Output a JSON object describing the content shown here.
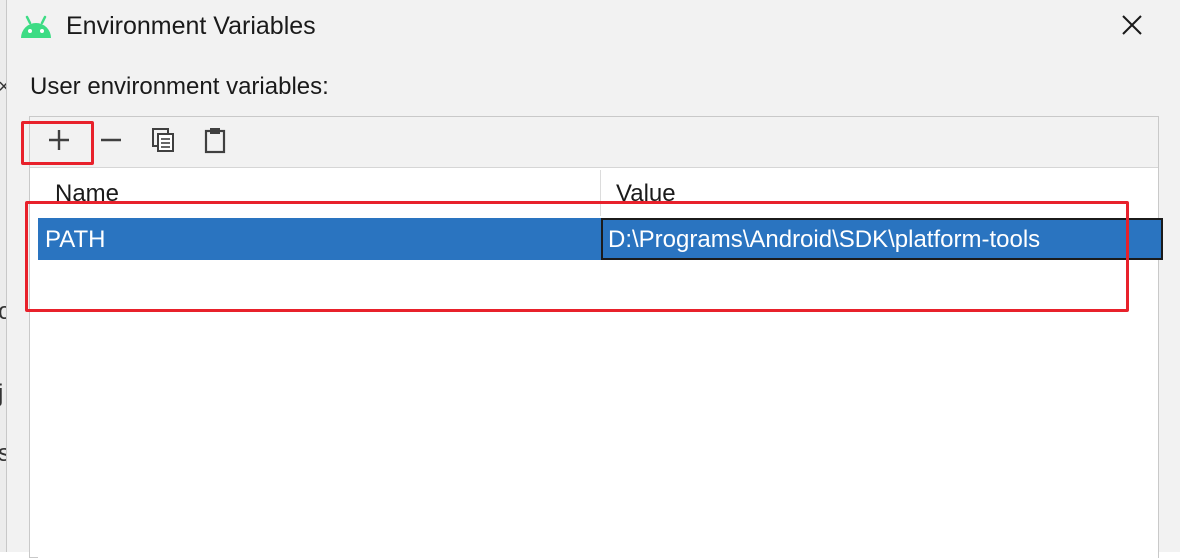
{
  "dialog": {
    "title": "Environment Variables",
    "section_label": "User environment variables:"
  },
  "icons": {
    "app": "android-icon",
    "close": "close-icon",
    "add": "plus-icon",
    "remove": "minus-icon",
    "copy": "copy-icon",
    "paste": "paste-icon"
  },
  "table": {
    "columns": [
      "Name",
      "Value"
    ],
    "rows": [
      {
        "name": "PATH",
        "value": "D:\\Programs\\Android\\SDK\\platform-tools",
        "selected": true
      }
    ]
  },
  "background_glyphs": [
    "×",
    "o",
    "j",
    "s"
  ],
  "colors": {
    "selection": "#2a74c0",
    "highlight": "#e8212b",
    "android_green": "#3ddc84"
  }
}
